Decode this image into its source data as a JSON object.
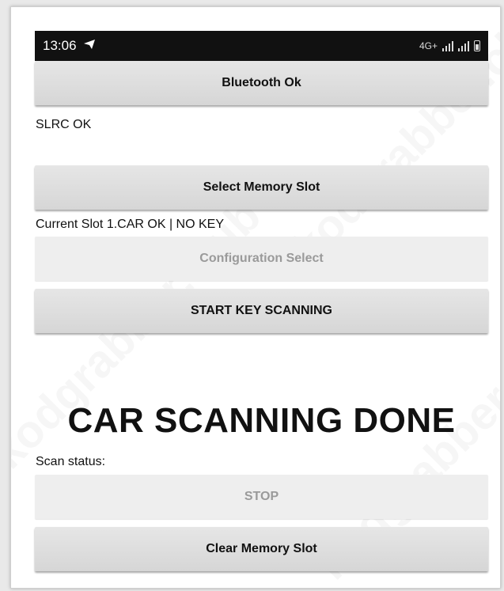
{
  "status_bar": {
    "time": "13:06",
    "network": "4G+"
  },
  "buttons": {
    "bluetooth": "Bluetooth Ok",
    "select_slot": "Select Memory Slot",
    "config_select": "Configuration Select",
    "start_scan": "START KEY SCANNING",
    "stop": "STOP",
    "clear_slot": "Clear Memory Slot"
  },
  "labels": {
    "slrc": "SLRC OK",
    "current_slot": "Current Slot  1.CAR OK | NO KEY",
    "headline": "CAR SCANNING DONE",
    "scan_status": "Scan status:"
  },
  "watermark": {
    "text": "kodgrabber.club"
  },
  "icons": {
    "telegram": "telegram-icon",
    "signal": "signal-icon",
    "battery": "battery-icon"
  },
  "colors": {
    "status_bar_bg": "#111111",
    "button_bg": "#dcdcdc",
    "disabled_text": "#9a9a9a"
  }
}
